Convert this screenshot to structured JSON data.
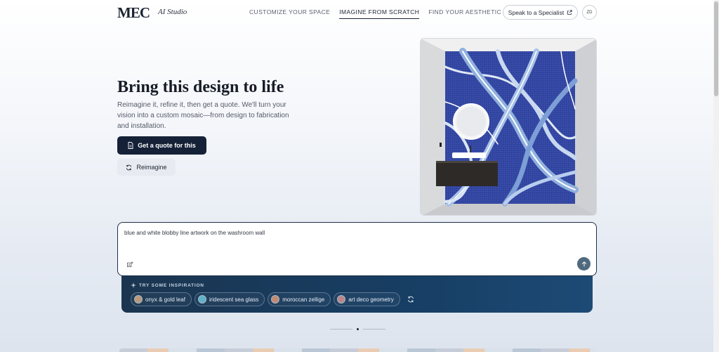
{
  "header": {
    "logo": "MEC",
    "logo_sub": "AI Studio",
    "nav": [
      "CUSTOMIZE YOUR SPACE",
      "IMAGINE FROM SCRATCH",
      "FIND YOUR AESTHETIC"
    ],
    "active_nav": "IMAGINE FROM SCRATCH",
    "specialist_label": "Speak to a Specialist",
    "avatar_initials": "ZD"
  },
  "hero": {
    "title": "Bring this design to life",
    "description": "Reimagine it, refine it, then get a quote. We'll turn your vision into a custom mosaic—from design to fabrication and installation.",
    "quote_button": "Get a quote for this",
    "reimagine_button": "Reimagine"
  },
  "prompt": {
    "value": "blue and white blobby line artwork on the washroom wall"
  },
  "inspiration": {
    "label": "TRY SOME INSPIRATION",
    "chips": [
      {
        "label": "onyx & gold leaf",
        "color": "#b89a7a"
      },
      {
        "label": "iridescent sea glass",
        "color": "#5fb3c9"
      },
      {
        "label": "moroccan zellige",
        "color": "#c28a72"
      },
      {
        "label": "art deco geometry",
        "color": "#b8888a"
      }
    ]
  },
  "colors": {
    "accent_dark": "#152137",
    "mosaic_blue": "#3a4fa8",
    "send_button": "#4f6a7e"
  },
  "icons": {
    "external_link": "external-link-icon",
    "document": "document-icon",
    "refresh": "refresh-icon",
    "sparkle": "sparkle-icon",
    "attach": "image-attach-icon",
    "send": "arrow-up-icon"
  }
}
